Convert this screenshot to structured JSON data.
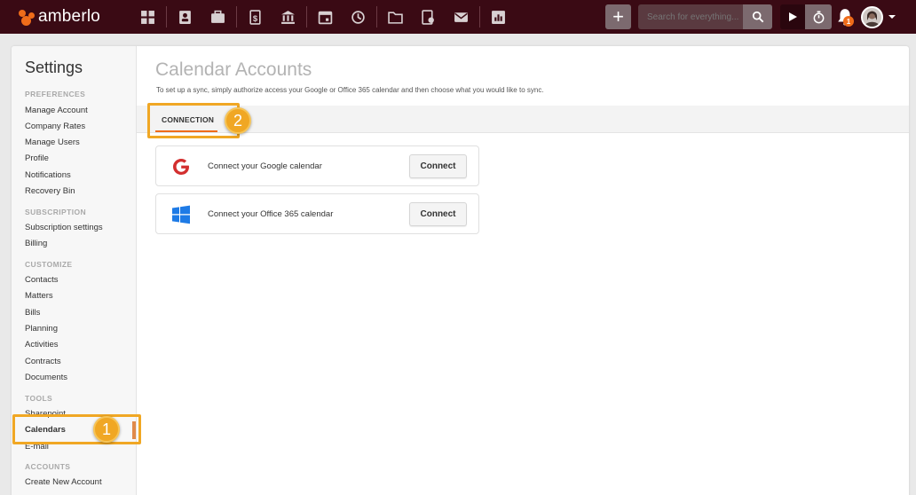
{
  "brand": {
    "name": "amberlo",
    "accent": "#ef6c1a",
    "topbar_bg": "#3a0a14"
  },
  "topbar": {
    "nav_icons": [
      "dashboard-icon",
      "contacts-icon",
      "matters-icon",
      "bills-icon",
      "bank-icon",
      "calendar-icon",
      "time-icon",
      "folder-icon",
      "contracts-icon",
      "mail-icon",
      "reports-icon"
    ],
    "search_placeholder": "Search for everything...",
    "notification_count": "1"
  },
  "sidebar": {
    "title": "Settings",
    "sections": [
      {
        "header": "PREFERENCES",
        "items": [
          "Manage Account",
          "Company Rates",
          "Manage Users",
          "Profile",
          "Notifications",
          "Recovery Bin"
        ]
      },
      {
        "header": "SUBSCRIPTION",
        "items": [
          "Subscription settings",
          "Billing"
        ]
      },
      {
        "header": "CUSTOMIZE",
        "items": [
          "Contacts",
          "Matters",
          "Bills",
          "Planning",
          "Activities",
          "Contracts",
          "Documents"
        ]
      },
      {
        "header": "TOOLS",
        "items": [
          "Sharepoint",
          "Calendars",
          "E-mail"
        ]
      },
      {
        "header": "ACCOUNTS",
        "items": [
          "Create New Account"
        ]
      }
    ],
    "active_item": "Calendars"
  },
  "main": {
    "title": "Calendar Accounts",
    "subtitle": "To set up a sync, simply authorize access your Google or Office 365 calendar and then choose what you would like to sync.",
    "tabs": [
      {
        "label": "CONNECTION"
      }
    ],
    "cards": [
      {
        "label": "Connect your Google calendar",
        "button": "Connect",
        "icon": "google-icon"
      },
      {
        "label": "Connect your Office 365 calendar",
        "button": "Connect",
        "icon": "windows-icon"
      }
    ]
  },
  "callouts": {
    "one": "1",
    "two": "2"
  }
}
